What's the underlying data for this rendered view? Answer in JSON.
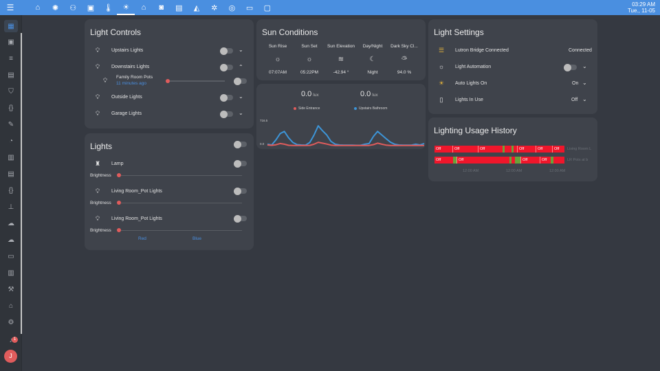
{
  "topbar": {
    "menu_icon": "menu-icon",
    "tabs": [
      "home-icon",
      "lamp-icon",
      "people-icon",
      "calendar-icon",
      "thermometer-icon",
      "lightbulb-icon",
      "garage-icon",
      "washer-icon",
      "image-icon",
      "cctv-icon",
      "hvac-icon",
      "robot-vacuum-icon",
      "laptop-icon",
      "car-icon"
    ],
    "active_tab": 5,
    "time": "03:29 AM",
    "date": "Tue., 11-05"
  },
  "sidebar": {
    "items": [
      "grid-icon",
      "person-card-icon",
      "list-icon",
      "script-icon",
      "shield-icon",
      "code-braces-icon",
      "wrench-icon",
      "speedometer-icon",
      "calendar-icon",
      "list-box-icon",
      "braces-icon",
      "sitemap-icon",
      "cloud-upload-icon",
      "cloud-icon",
      "monitor-icon",
      "chart-icon",
      "hammer-icon",
      "home-icon",
      "gear-icon",
      "bell-icon"
    ],
    "notification_count": "1",
    "avatar_initial": "J"
  },
  "light_controls": {
    "title": "Light Controls",
    "rows": [
      {
        "label": "Upstairs Lights",
        "icon": "lightbulb-icon"
      },
      {
        "label": "Downstairs Lights",
        "icon": "lightbulb-icon"
      },
      {
        "label": "Family Room Pots",
        "sub": "11 minutes ago",
        "icon": "lightbulb-icon"
      },
      {
        "label": "Outside Lights",
        "icon": "lightbulb-icon"
      },
      {
        "label": "Garage Lights",
        "icon": "lightbulb-icon"
      }
    ]
  },
  "lights": {
    "title": "Lights",
    "rows": [
      {
        "label": "Lamp",
        "icon": "lamp-icon",
        "slider_label": "Brightness"
      },
      {
        "label": "Living Room_Pot Lights",
        "icon": "lightbulb-icon",
        "slider_label": "Brightness"
      },
      {
        "label": "Living Room_Pot Lights",
        "icon": "lightbulb-icon",
        "slider_label": "Brightness"
      }
    ],
    "color_buttons": [
      "Red",
      "Blue"
    ]
  },
  "sun": {
    "title": "Sun Conditions",
    "columns": [
      {
        "label": "Sun Rise",
        "icon": "sunrise-icon",
        "value": "07:07AM"
      },
      {
        "label": "Sun Set",
        "icon": "sunset-icon",
        "value": "05:22PM"
      },
      {
        "label": "Sun Elevation",
        "icon": "elevation-icon",
        "value": "-42.94 °"
      },
      {
        "label": "Day/Night",
        "icon": "night-icon",
        "value": "Night"
      },
      {
        "label": "Dark Sky Cl...",
        "icon": "cloud-sun-icon",
        "value": "94.0 %"
      }
    ]
  },
  "lux": {
    "readings": [
      {
        "value": "0.0",
        "unit": "lux"
      },
      {
        "value": "0.0",
        "unit": "lux"
      }
    ]
  },
  "chart_data": {
    "type": "line",
    "title": "",
    "ylim": [
      0.0,
      716.5
    ],
    "ytick_labels": [
      "716.5",
      "0.0"
    ],
    "series": [
      {
        "name": "Side Entrance",
        "color": "#e05c5c",
        "values": [
          20,
          10,
          25,
          60,
          40,
          10,
          5,
          5,
          5,
          5,
          8,
          40,
          95,
          70,
          45,
          15,
          5,
          5,
          5,
          5,
          5,
          5,
          5,
          5,
          5,
          30,
          70,
          40,
          15,
          5,
          5,
          5,
          5,
          5,
          5,
          5,
          5,
          5
        ]
      },
      {
        "name": "Upstairs Bathroom",
        "color": "#3d95d8",
        "values": [
          40,
          20,
          160,
          340,
          400,
          220,
          90,
          30,
          20,
          15,
          90,
          300,
          560,
          420,
          300,
          120,
          40,
          20,
          15,
          15,
          15,
          10,
          10,
          40,
          60,
          260,
          400,
          300,
          200,
          100,
          40,
          20,
          15,
          15,
          15,
          40,
          20,
          60
        ]
      }
    ]
  },
  "light_settings": {
    "title": "Light Settings",
    "rows": [
      {
        "label": "Lutron Bridge Connected",
        "icon": "server-icon",
        "state": "Connected"
      },
      {
        "label": "Light Automation",
        "icon": "lightbulb-outline-icon"
      },
      {
        "label": "Auto Lights On",
        "icon": "lightbulb-on-icon",
        "state": "On"
      },
      {
        "label": "Lights In Use",
        "icon": "remote-icon",
        "state": "Off"
      }
    ]
  },
  "history": {
    "title": "Lighting Usage History",
    "rows": [
      {
        "name": "Living Room L",
        "segments": [
          "Off",
          "Off",
          "Off",
          "Off",
          "Off",
          "Off"
        ]
      },
      {
        "name": "LR Pots at b",
        "segments": [
          "Off",
          "Off",
          "Off",
          "Off"
        ]
      }
    ],
    "times": [
      "12:00 AM",
      "12:00 AM",
      "12:00 AM"
    ]
  }
}
